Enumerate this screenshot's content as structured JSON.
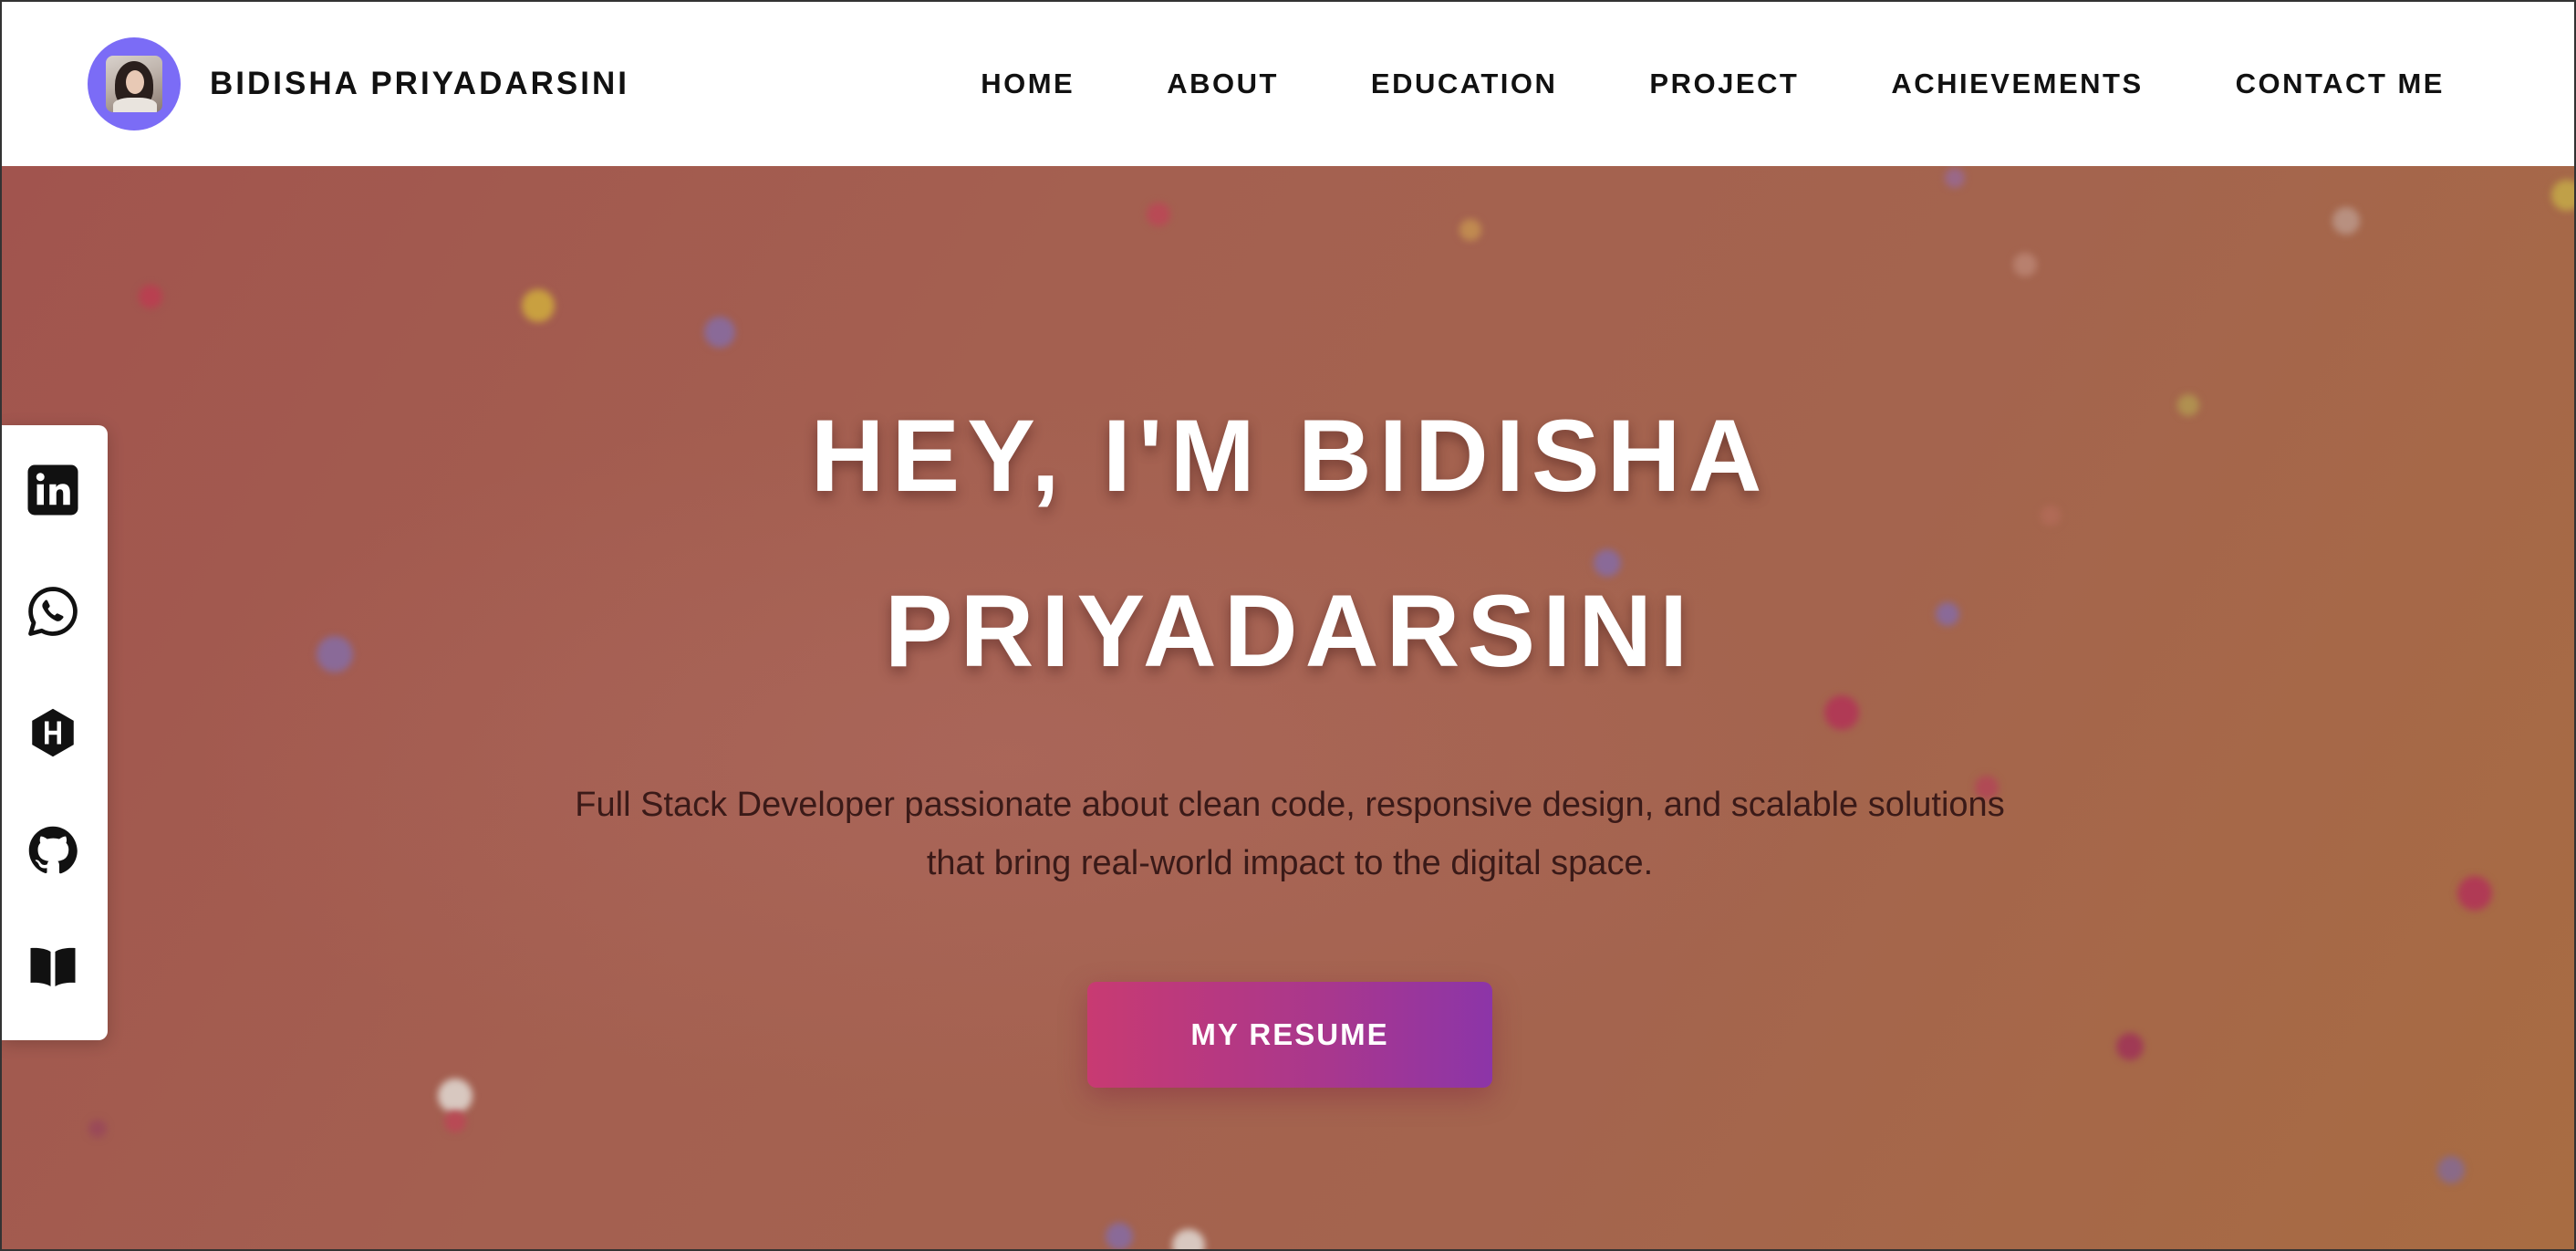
{
  "brand": {
    "name": "BIDISHA PRIYADARSINI",
    "avatar_icon": "profile-photo"
  },
  "nav": {
    "items": [
      {
        "label": "HOME"
      },
      {
        "label": "ABOUT"
      },
      {
        "label": "EDUCATION"
      },
      {
        "label": "PROJECT"
      },
      {
        "label": "ACHIEVEMENTS"
      },
      {
        "label": "CONTACT ME"
      }
    ]
  },
  "hero": {
    "title_line1": "HEY, I'M BIDISHA",
    "title_line2": "PRIYADARSINI",
    "subtitle_line1": "Full Stack Developer passionate about clean code, responsive design, and scalable solutions",
    "subtitle_line2": "that bring real-world impact to the digital space.",
    "cta_label": "MY RESUME"
  },
  "social": {
    "items": [
      {
        "icon": "linkedin-icon"
      },
      {
        "icon": "whatsapp-icon"
      },
      {
        "icon": "hackerrank-icon"
      },
      {
        "icon": "github-icon"
      },
      {
        "icon": "book-icon"
      }
    ]
  },
  "colors": {
    "accent": "#7b6cf6",
    "button_start": "#c83a72",
    "button_end": "#8c35a8",
    "hero_bg": "#a4604e"
  }
}
